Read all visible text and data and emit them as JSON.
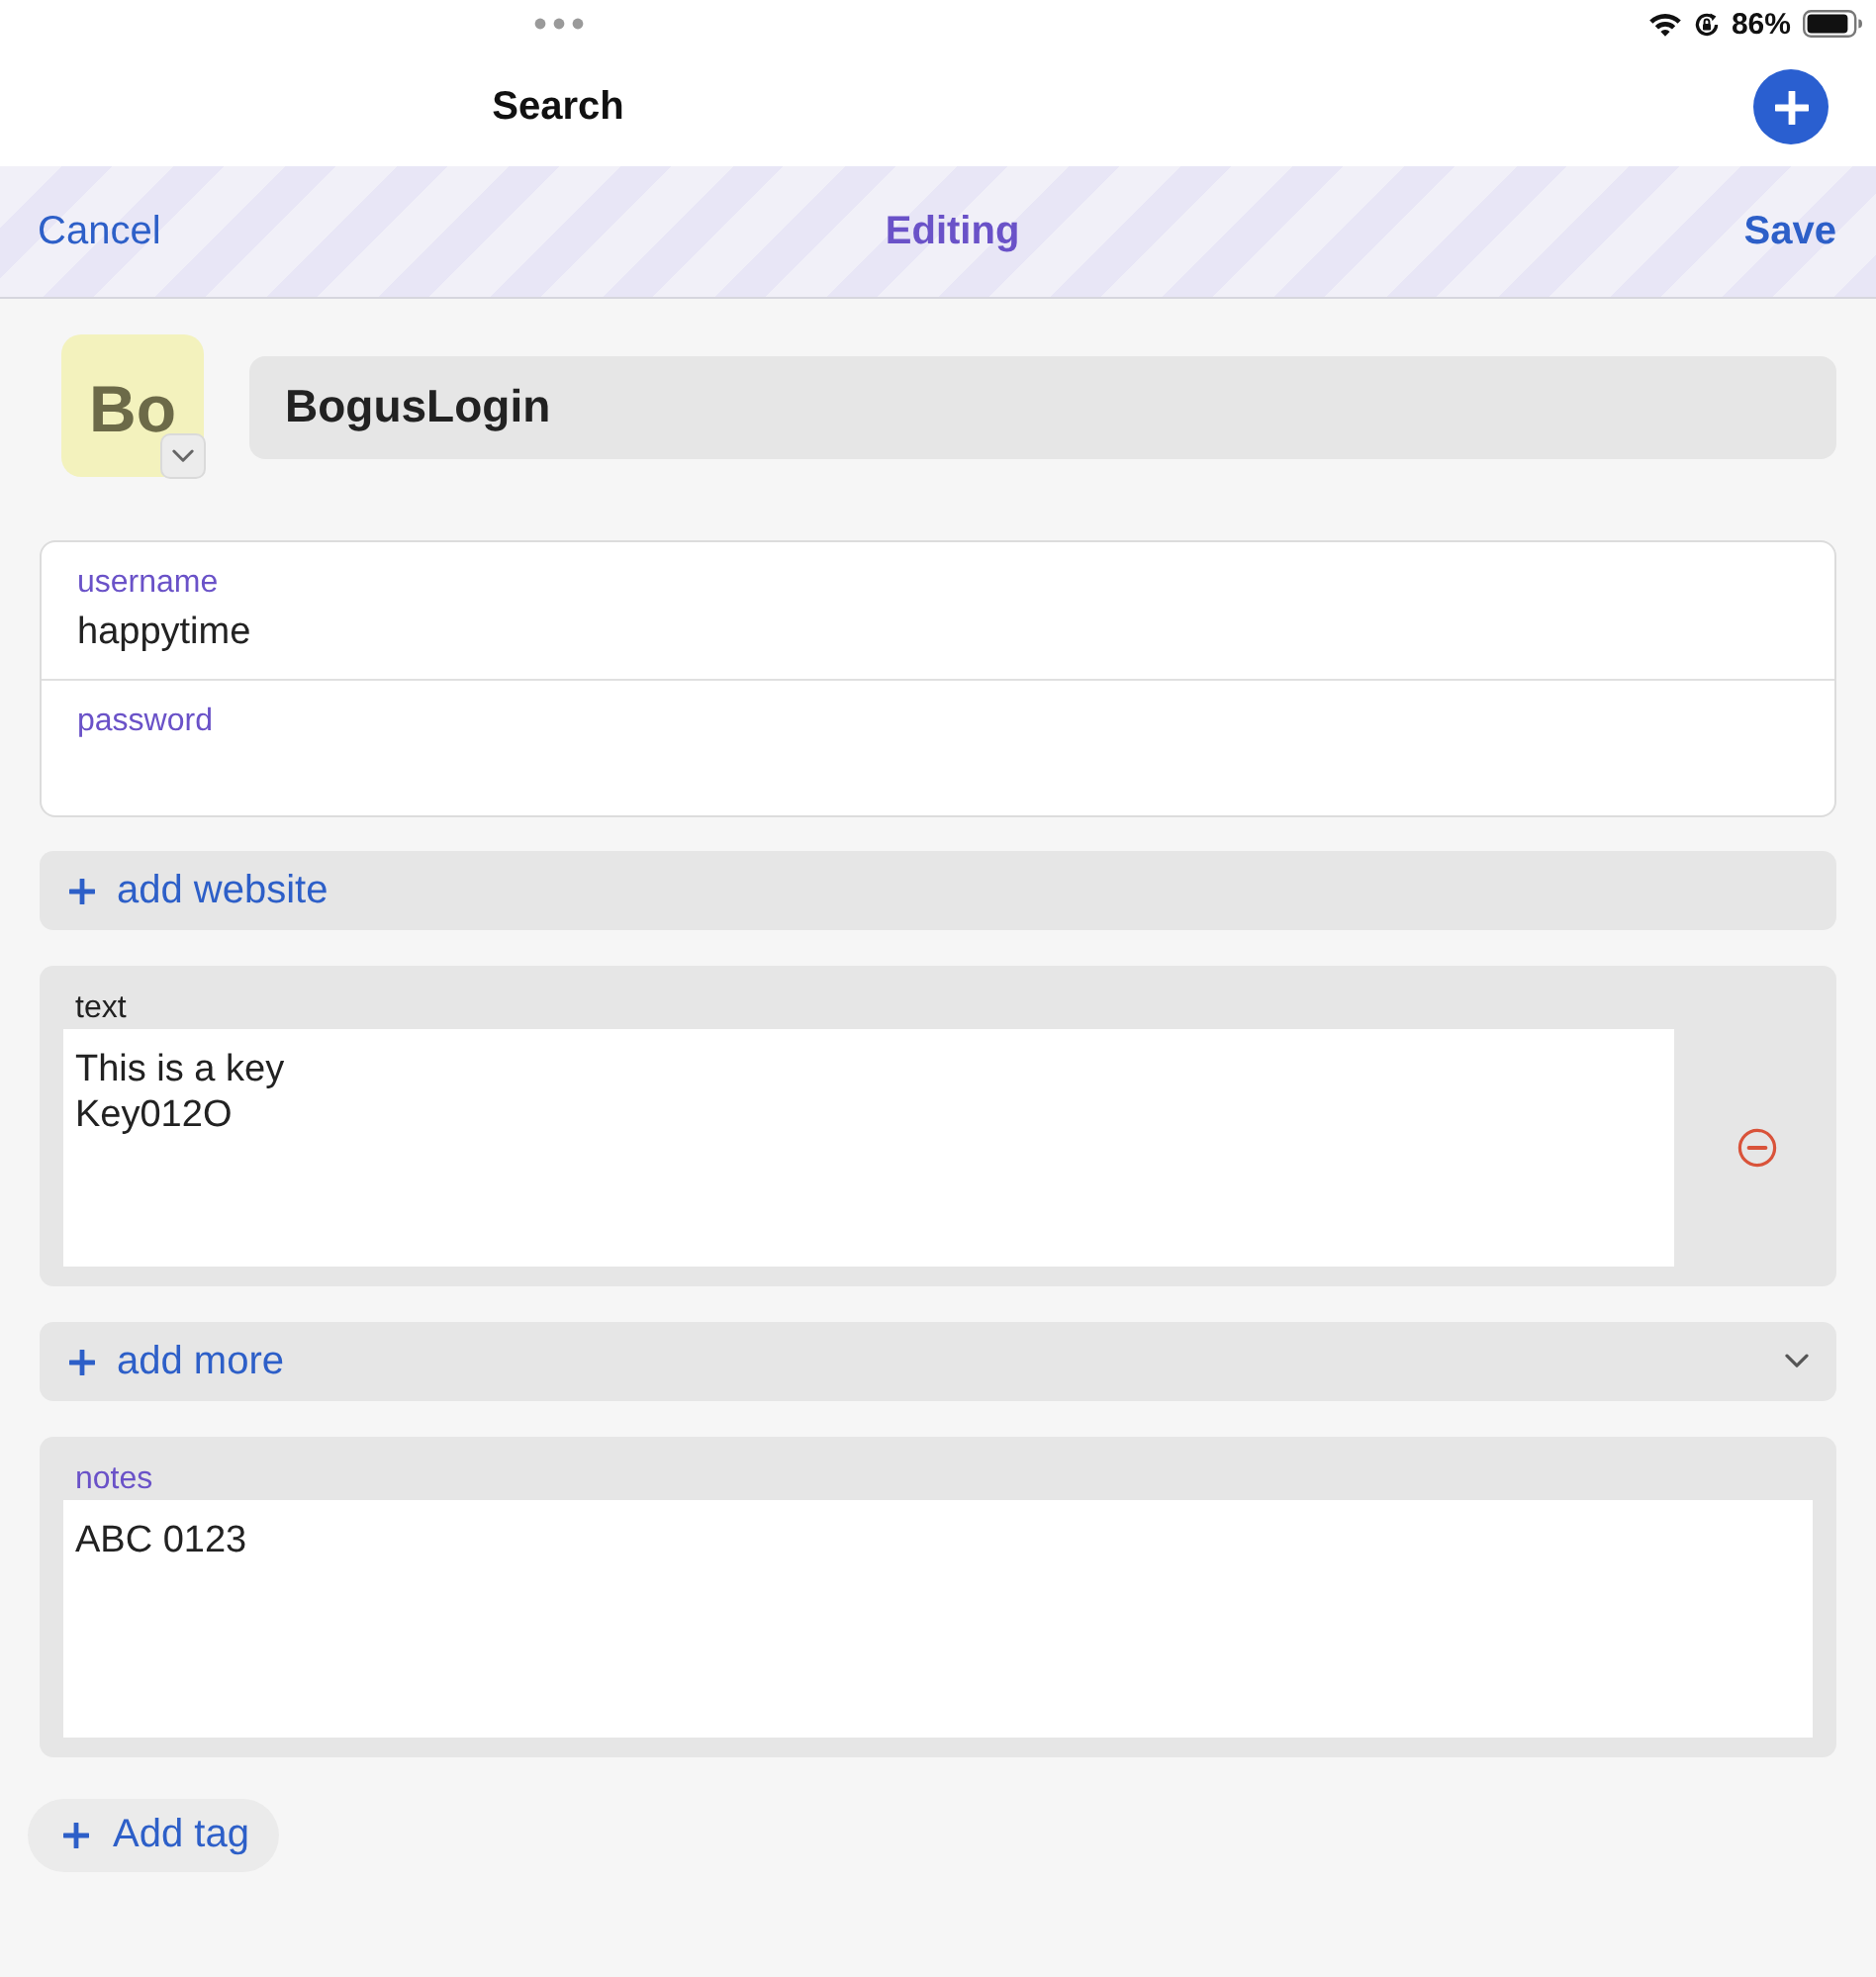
{
  "status_bar": {
    "battery_text": "86%"
  },
  "nav": {
    "title": "Search"
  },
  "edit_bar": {
    "cancel": "Cancel",
    "title": "Editing",
    "save": "Save"
  },
  "item": {
    "avatar": "Bo",
    "name": "BogusLogin"
  },
  "credentials": [
    {
      "label": "username",
      "value": "happytime"
    },
    {
      "label": "password"
    }
  ],
  "add_website": {
    "label": "add website"
  },
  "custom_fields": [
    {
      "kind": "text",
      "label": "text",
      "value": "This is a key\nKey012O"
    }
  ],
  "add_more": {
    "label": "add more"
  },
  "notes": {
    "label": "notes",
    "value": "ABC 0123"
  },
  "add_tag": {
    "label": "Add tag"
  }
}
